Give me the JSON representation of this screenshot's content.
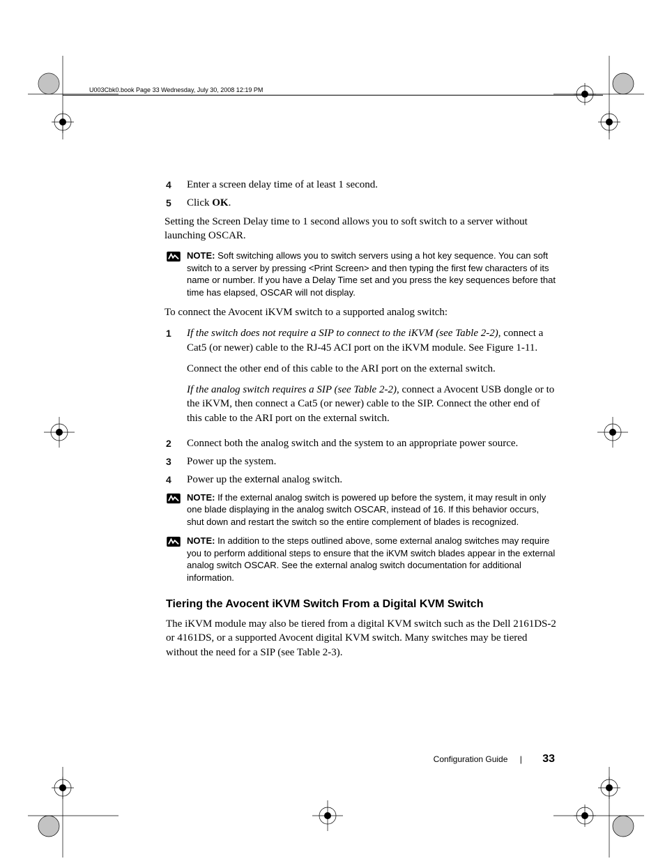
{
  "header": "U003Cbk0.book  Page 33  Wednesday, July 30, 2008  12:19 PM",
  "steps_a": [
    {
      "n": "4",
      "text": "Enter a screen delay time of at least 1 second."
    },
    {
      "n": "5",
      "text": "Click ",
      "bold_tail": "OK",
      "tail": "."
    }
  ],
  "para1": "Setting the Screen Delay time to 1 second allows you to soft switch to a server without launching OSCAR.",
  "note1_label": "NOTE:",
  "note1": " Soft switching allows you to switch servers using a hot key sequence. You can soft switch to a server by pressing <Print Screen> and then typing the first few characters of its name or number. If you have a Delay Time set and you press the key sequences before that time has elapsed, OSCAR will not display.",
  "para2": "To connect the Avocent iKVM switch to a supported analog switch:",
  "steps_b": {
    "item1": {
      "n": "1",
      "ital": "If the switch does not require a SIP to connect to the iKVM (see Table 2-2)",
      "text1": ", connect a Cat5 (or newer) cable to the RJ-45 ACI port on the iKVM module. See Figure 1-11.",
      "sub1": "Connect the other end of this cable to the ARI port on the external switch.",
      "ital2": "If the analog switch requires a SIP (see Table 2-2)",
      "text2": ", connect a Avocent USB dongle or to the iKVM, then connect a Cat5 (or newer) cable to the SIP. Connect the other end of this cable to the ARI port on the external switch."
    },
    "item2": {
      "n": "2",
      "text": "Connect both the analog switch and the system to an appropriate power source."
    },
    "item3": {
      "n": "3",
      "text": "Power up the system."
    },
    "item4": {
      "n": "4",
      "pre": "Power up the ",
      "sans": "external",
      "post": " analog switch."
    }
  },
  "note2_label": "NOTE:",
  "note2": " If the external analog switch is powered up before the system, it may result in only one blade displaying in the analog switch OSCAR, instead of 16. If this behavior occurs, shut down and restart the switch so the entire complement of blades is recognized.",
  "note3_label": "NOTE:",
  "note3": " In addition to the steps outlined above, some external analog switches may require you to perform additional steps to ensure that the iKVM switch blades appear in the external analog switch OSCAR. See the external analog switch documentation for additional information.",
  "heading": "Tiering the Avocent iKVM Switch From a Digital KVM Switch",
  "para3": "The iKVM module may also be tiered from a digital KVM switch such as the Dell 2161DS-2 or 4161DS, or a supported Avocent digital KVM switch. Many switches may be tiered without the need for a SIP (see Table 2-3).",
  "footer_label": "Configuration Guide",
  "footer_sep": "|",
  "footer_page": "33"
}
